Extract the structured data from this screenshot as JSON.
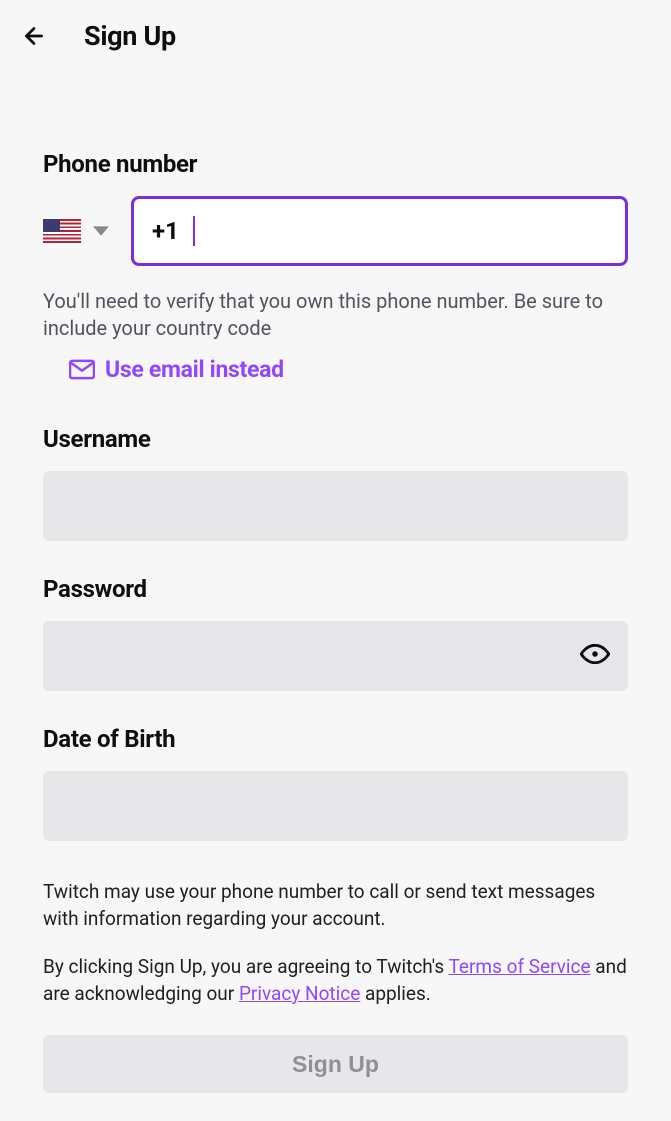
{
  "header": {
    "title": "Sign Up"
  },
  "phone": {
    "label": "Phone number",
    "prefix": "+1",
    "value": "",
    "country": "us",
    "hint": "You'll need to verify that you own this phone number. Be sure to include your country code"
  },
  "email_instead_label": "Use email instead",
  "username": {
    "label": "Username",
    "value": ""
  },
  "password": {
    "label": "Password",
    "value": ""
  },
  "dob": {
    "label": "Date of Birth",
    "value": ""
  },
  "legal": {
    "disclosure": "Twitch may use your phone number to call or send text messages with information regarding your account.",
    "agreement_prefix": "By clicking Sign Up, you are agreeing to Twitch's ",
    "tos_label": "Terms of Service",
    "agreement_mid": " and are acknowledging our ",
    "privacy_label": "Privacy Notice",
    "agreement_suffix": " applies."
  },
  "submit_label": "Sign Up",
  "colors": {
    "accent": "#9147ff",
    "focus_border": "#7c2fd9"
  }
}
